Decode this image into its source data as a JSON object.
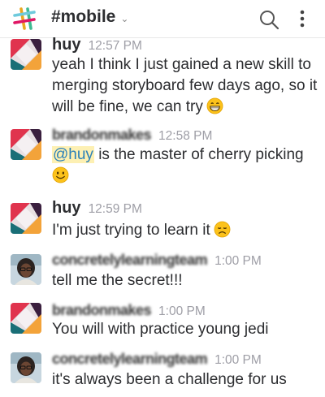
{
  "header": {
    "channel": "#mobile",
    "chevron": "⌄",
    "logo_icon": "slack-logo-icon",
    "search_icon": "search-icon",
    "more_icon": "more-vertical-icon"
  },
  "messages": [
    {
      "name": "huy",
      "time": "12:57 PM",
      "text": "yeah I think I just gained a new skill to merging storyboard few days ago, so it will be fine, we can try",
      "emoji": "grinning-face-icon",
      "avatar": "slack-tile-icon"
    },
    {
      "name": "brandonmakes",
      "time": "12:58 PM",
      "mention": "@huy",
      "text": "is the master of cherry picking",
      "emoji": "slightly-smiling-face-icon",
      "avatar": "slack-tile-icon"
    },
    {
      "name": "huy",
      "time": "12:59 PM",
      "text": "I'm just trying to learn it",
      "emoji": "disappointed-face-icon",
      "avatar": "slack-tile-icon"
    },
    {
      "name": "concretelylearningteam",
      "time": "1:00 PM",
      "text": "tell me the secret!!!",
      "avatar": "user-photo-icon"
    },
    {
      "name": "brandonmakes",
      "time": "1:00 PM",
      "text": "You will with practice young jedi",
      "avatar": "slack-tile-icon"
    },
    {
      "name": "concretelylearningteam",
      "time": "1:00 PM",
      "text": "it's always been a challenge for us",
      "avatar": "user-photo-icon"
    }
  ],
  "colors": {
    "mention_bg": "#fdf0b3",
    "mention_text": "#2a80b9",
    "timestamp": "#9e9ea6"
  }
}
